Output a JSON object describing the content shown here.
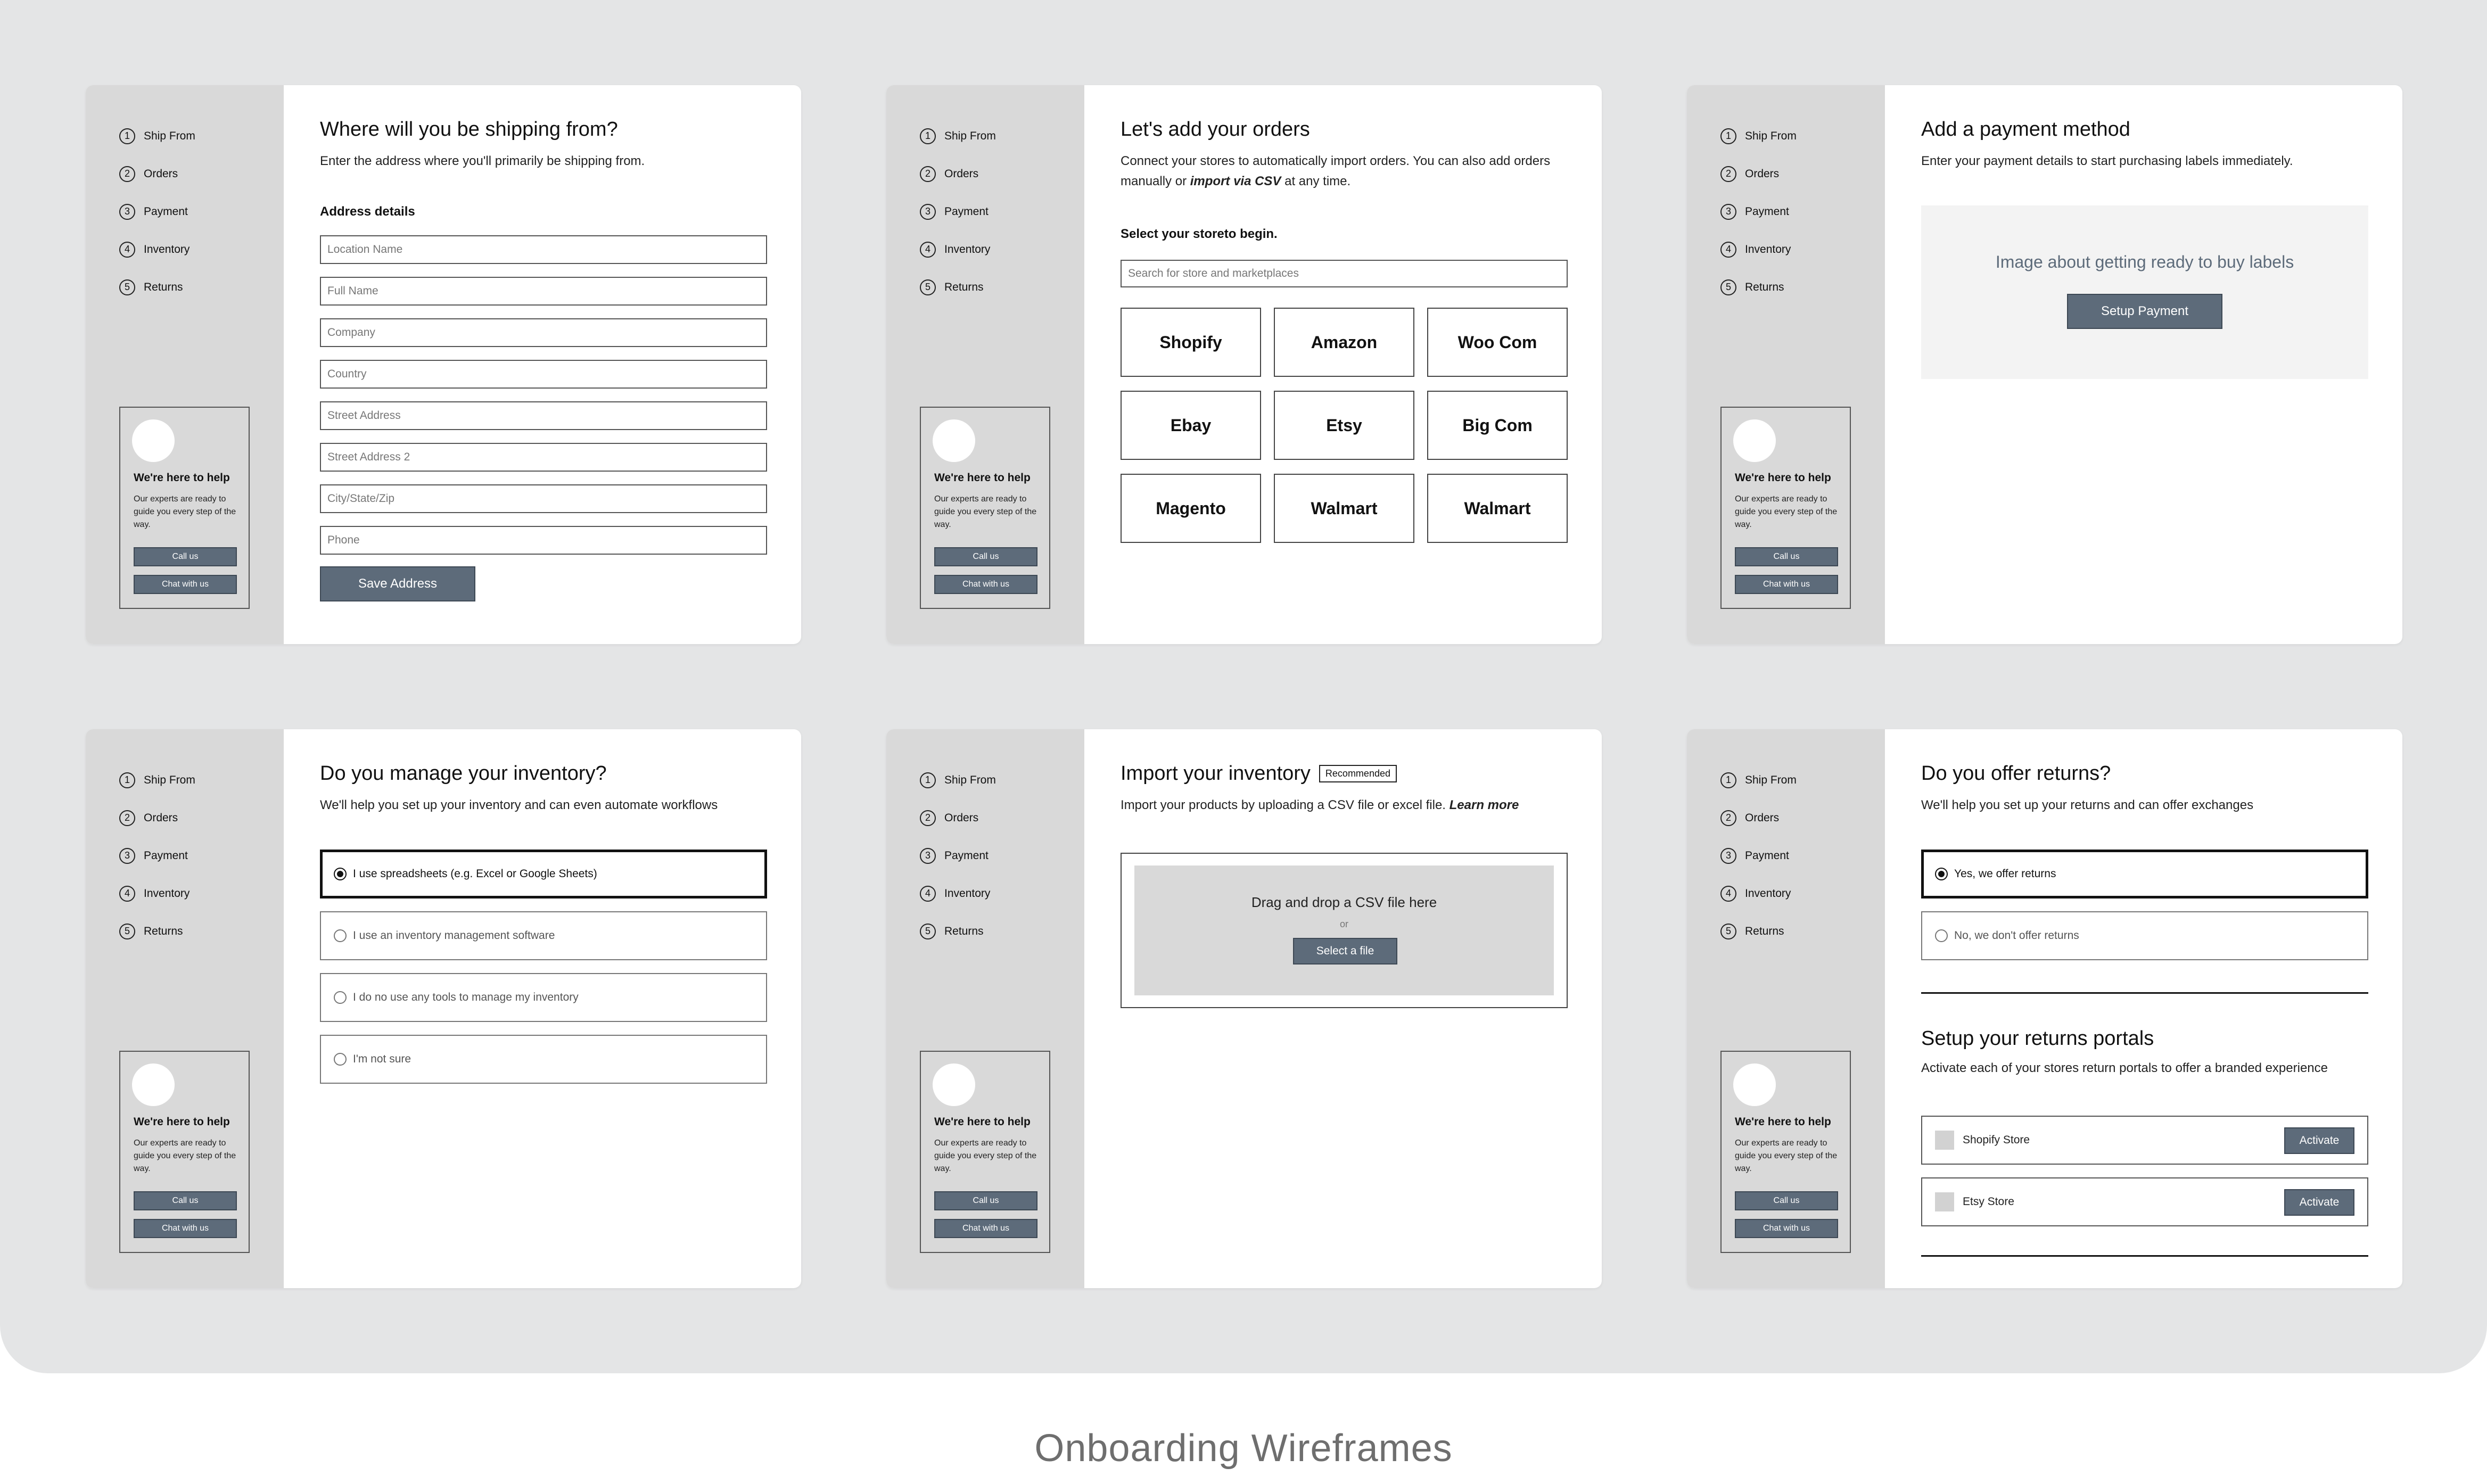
{
  "caption": "Onboarding Wireframes",
  "steps": [
    "Ship From",
    "Orders",
    "Payment",
    "Inventory",
    "Returns"
  ],
  "help": {
    "title": "We're here to help",
    "text": "Our experts are ready to guide you every step of the way.",
    "call": "Call us",
    "chat": "Chat with us"
  },
  "ship": {
    "title": "Where will you be shipping from?",
    "subtitle": "Enter the address where you'll primarily be shipping from.",
    "section": "Address details",
    "fields": [
      "Location Name",
      "Full Name",
      "Company",
      "Country",
      "Street Address",
      "Street Address 2",
      "City/State/Zip",
      "Phone"
    ],
    "button": "Save Address"
  },
  "orders": {
    "title": "Let's add your orders",
    "subtitle_a": "Connect your stores to automatically import orders. You can also add orders manually or ",
    "subtitle_em": "import via CSV",
    "subtitle_b": " at any time.",
    "select_label": "Select your storeto begin.",
    "search_placeholder": "Search for store and marketplaces",
    "stores": [
      "Shopify",
      "Amazon",
      "Woo Com",
      "Ebay",
      "Etsy",
      "Big Com",
      "Magento",
      "Walmart",
      "Walmart"
    ]
  },
  "payment": {
    "title": "Add a payment method",
    "subtitle": "Enter your payment details to start purchasing labels immediately.",
    "image_text": "Image about getting ready to buy labels",
    "button": "Setup Payment"
  },
  "inventory": {
    "title": "Do you manage your inventory?",
    "subtitle": "We'll help you set up your inventory and can even automate workflows",
    "options": [
      "I use spreadsheets (e.g. Excel or Google Sheets)",
      "I use an inventory management software",
      "I do no use any tools to manage my inventory",
      "I'm not sure"
    ]
  },
  "import": {
    "title": "Import your inventory",
    "badge": "Recommended",
    "subtitle": "Import your products by uploading a CSV file or excel file.",
    "learn": "Learn more",
    "drop_text": "Drag and drop a CSV file here",
    "or": "or",
    "button": "Select a file"
  },
  "returns": {
    "title": "Do you offer returns?",
    "subtitle": "We'll help you set up your returns and can offer exchanges",
    "options": [
      "Yes, we offer returns",
      "No, we don't offer returns"
    ],
    "portals_title": "Setup your returns portals",
    "portals_subtitle": "Activate each of your stores return portals to offer a branded experience",
    "portals": [
      "Shopify Store",
      "Etsy Store"
    ],
    "activate": "Activate"
  }
}
